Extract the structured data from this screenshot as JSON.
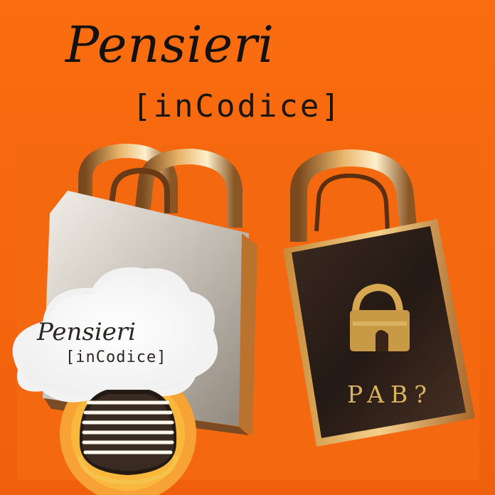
{
  "cover": {
    "title": "Pensieri",
    "subtitle": "[inCodice]",
    "background_color": "#f86a10"
  },
  "badge": {
    "title": "Pensieri",
    "subtitle": "[inCodice]",
    "icon": "microphone-icon"
  },
  "padlocks": {
    "engraving": "PAB?"
  }
}
